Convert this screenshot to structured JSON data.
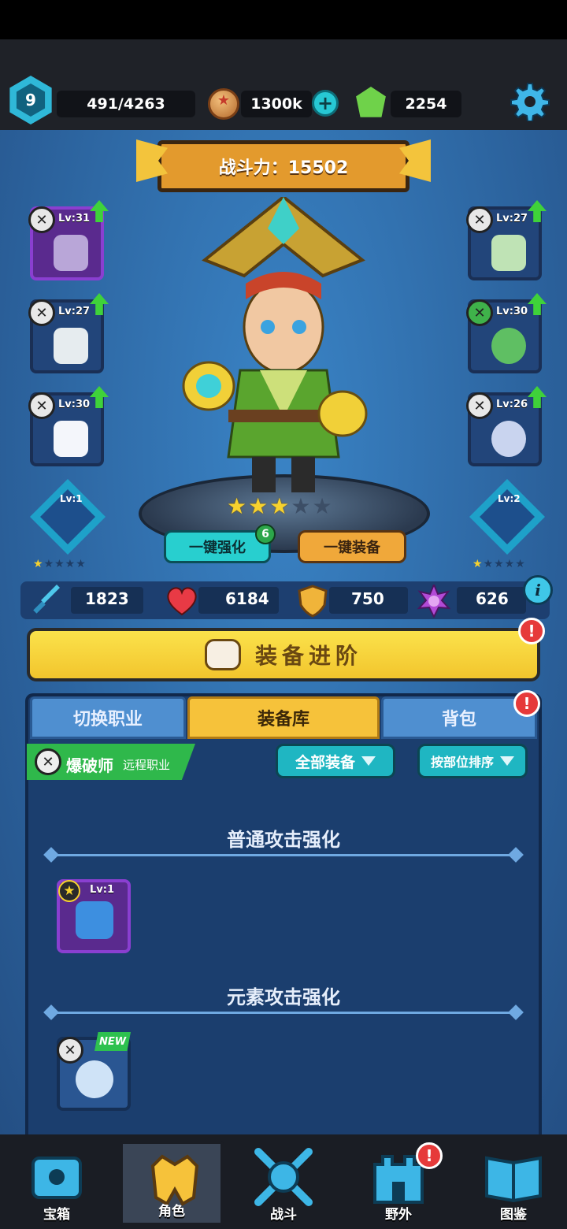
{
  "player": {
    "level": "9",
    "exp": "491/4263"
  },
  "currency": {
    "gold": "1300k",
    "gems": "2254"
  },
  "power": {
    "label": "战斗力：15502"
  },
  "equip_left": [
    {
      "lv": "Lv:31"
    },
    {
      "lv": "Lv:27"
    },
    {
      "lv": "Lv:30"
    }
  ],
  "equip_right": [
    {
      "lv": "Lv:27"
    },
    {
      "lv": "Lv:30"
    },
    {
      "lv": "Lv:26"
    }
  ],
  "runes": {
    "left": {
      "lv": "Lv:1",
      "stars": 1
    },
    "right": {
      "lv": "Lv:2",
      "stars": 1
    }
  },
  "hero": {
    "stars": 3,
    "max_stars": 5
  },
  "buttons": {
    "auto_upgrade": "一键强化",
    "auto_upgrade_badge": "6",
    "auto_equip": "一键装备"
  },
  "stats": {
    "attack": "1823",
    "health": "6184",
    "defense": "750",
    "special": "626",
    "info": "i"
  },
  "advance": {
    "label": "装备进阶",
    "alert": "!"
  },
  "tabs": [
    {
      "label": "切换职业"
    },
    {
      "label": "装备库"
    },
    {
      "label": "背包"
    }
  ],
  "job": {
    "name": "爆破师",
    "sub": "远程职业"
  },
  "filters": {
    "category": "全部装备",
    "sort": "按部位排序"
  },
  "sections": [
    {
      "title": "普通攻击强化",
      "items": [
        {
          "lv": "Lv:1"
        }
      ]
    },
    {
      "title": "元素攻击强化",
      "items": [
        {
          "badge": "NEW"
        }
      ]
    }
  ],
  "nav": [
    {
      "label": "宝箱"
    },
    {
      "label": "角色"
    },
    {
      "label": "战斗"
    },
    {
      "label": "野外"
    },
    {
      "label": "图鉴"
    }
  ],
  "colors": {
    "accent_yellow": "#f6c23a",
    "accent_teal": "#28cfcf",
    "bg_blue": "#2a5f99",
    "alert_red": "#e63a3a"
  }
}
